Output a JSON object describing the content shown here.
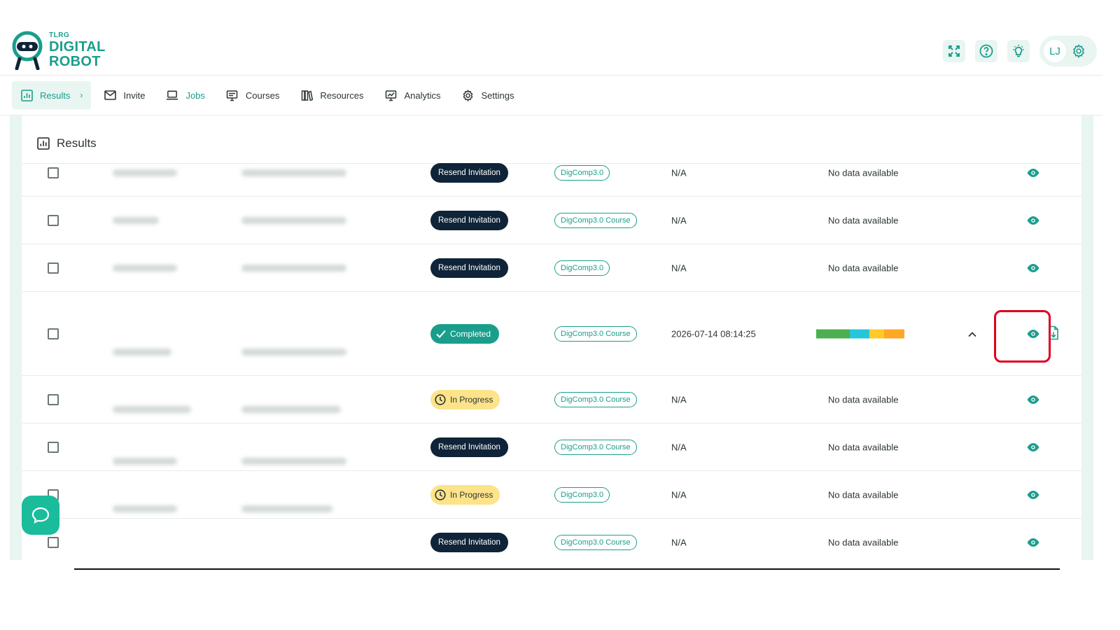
{
  "brand": {
    "small": "TLRG",
    "line1": "DIGITAL",
    "line2": "ROBOT"
  },
  "user": {
    "initials": "LJ"
  },
  "colors": {
    "accent": "#1a9e8c",
    "dark_badge": "#0f2438",
    "progress_badge": "#fde38a",
    "highlight": "#e0001b"
  },
  "nav": {
    "items": [
      {
        "label": "Results",
        "icon": "bar-chart-icon"
      },
      {
        "label": "Invite",
        "icon": "mail-icon"
      },
      {
        "label": "Jobs",
        "icon": "laptop-icon"
      },
      {
        "label": "Courses",
        "icon": "presentation-icon"
      },
      {
        "label": "Resources",
        "icon": "books-icon"
      },
      {
        "label": "Analytics",
        "icon": "monitor-chart-icon"
      },
      {
        "label": "Settings",
        "icon": "gear-icon"
      }
    ]
  },
  "panel": {
    "title": "Results"
  },
  "rows": [
    {
      "status": "Resend Invitation",
      "course": "DigComp3.0",
      "date": "N/A",
      "result": "No data available"
    },
    {
      "status": "Resend Invitation",
      "course": "DigComp3.0 Course",
      "date": "N/A",
      "result": "No data available"
    },
    {
      "status": "Resend Invitation",
      "course": "DigComp3.0",
      "date": "N/A",
      "result": "No data available"
    },
    {
      "status": "Completed",
      "course": "DigComp3.0 Course",
      "date": "2026-07-14 08:14:25",
      "result": ""
    },
    {
      "status": "In Progress",
      "course": "DigComp3.0 Course",
      "date": "N/A",
      "result": "No data available"
    },
    {
      "status": "Resend Invitation",
      "course": "DigComp3.0 Course",
      "date": "N/A",
      "result": "No data available"
    },
    {
      "status": "In Progress",
      "course": "DigComp3.0",
      "date": "N/A",
      "result": "No data available"
    },
    {
      "status": "Resend Invitation",
      "course": "DigComp3.0 Course",
      "date": "N/A",
      "result": "No data available"
    }
  ],
  "score_bar": {
    "segments": [
      {
        "color": "#4caf50",
        "share": 0.38
      },
      {
        "color": "#26c6da",
        "share": 0.22
      },
      {
        "color": "#ffca28",
        "share": 0.17
      },
      {
        "color": "#ffa726",
        "share": 0.23
      }
    ]
  }
}
